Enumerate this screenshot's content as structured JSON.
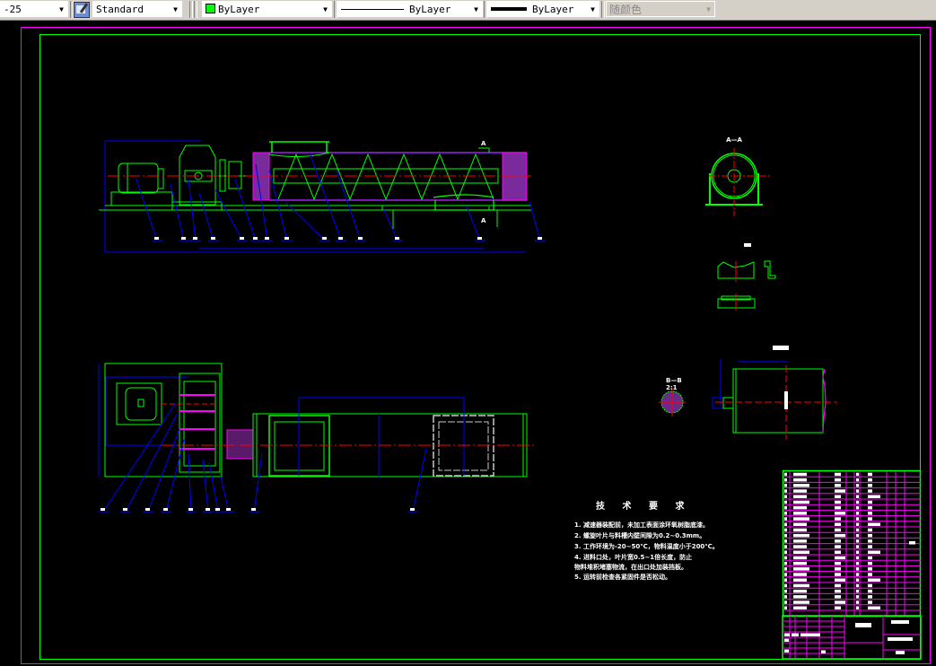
{
  "toolbar": {
    "dimscale_value": "-25",
    "text_style_icon": "text-style-icon",
    "text_style": "Standard",
    "color_value": "ByLayer",
    "color_swatch": "#00ff00",
    "linetype_value": "ByLayer",
    "lineweight_value": "ByLayer",
    "plotstyle_value": "随颜色"
  },
  "drawing": {
    "background": "#000000",
    "colors": {
      "border": "#ff00ff",
      "frame": "#00ff00",
      "centerline": "#ff0000",
      "dimension": "#0000ff",
      "section": "#a020f0",
      "text": "#ffffff"
    },
    "section_aa_label": "A—A",
    "section_mark": "A",
    "section_bb_label": "B—B",
    "section_bb_scale": "2:1",
    "technical_requirements": {
      "title": "技 术 要 求",
      "items": [
        "1. 减速器装配前，未加工表面涂环氧树脂底漆。",
        "2. 螺旋叶片与料槽内壁间隙为0.2~0.3mm。",
        "3. 工作环境为-20~50℃，物料温度小于200℃。",
        "4. 进料口处，叶片宽0.5~1倍长度，防止",
        "   物料堆积堵塞物流，在出口处加装挡板。",
        "5. 运转前检查各紧固件是否松动。"
      ]
    }
  }
}
